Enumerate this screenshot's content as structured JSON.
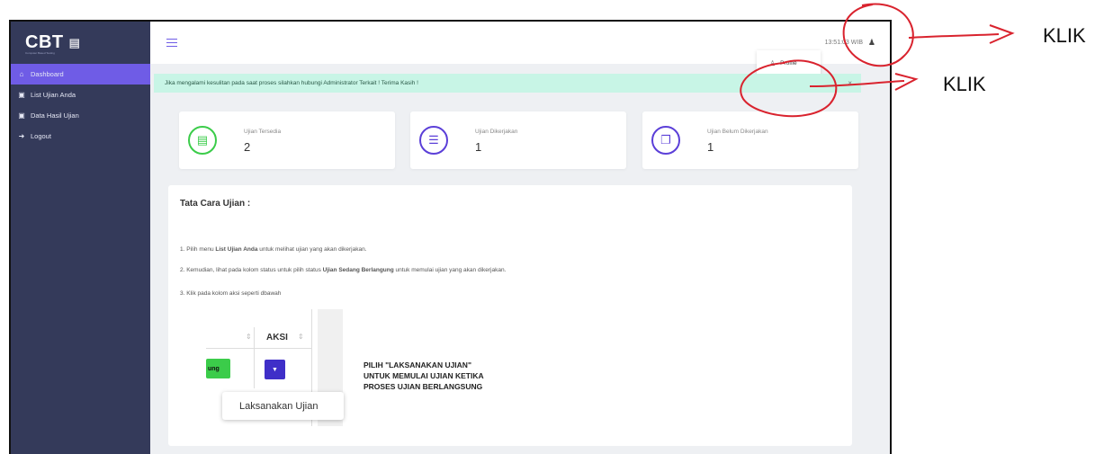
{
  "app": {
    "brand": "CBT",
    "brand_sub": "Computer Based Testing"
  },
  "sidebar": {
    "items": [
      {
        "label": "Dashboard",
        "icon": "home-icon",
        "active": true
      },
      {
        "label": "List Ujian Anda",
        "icon": "calendar-icon"
      },
      {
        "label": "Data Hasil Ujian",
        "icon": "calendar-icon"
      },
      {
        "label": "Logout",
        "icon": "logout-icon"
      }
    ]
  },
  "topbar": {
    "clock": "13:51:03 WIB",
    "user_icon": "user-icon"
  },
  "user_menu": {
    "profile_label": "Profile"
  },
  "alert": {
    "text": "Jika mengalami kesulitan pada saat proses silahkan hubungi Administrator Terkait ! Terima Kasih !",
    "close": "×"
  },
  "stats": [
    {
      "label": "Ujian Tersedia",
      "value": "2",
      "icon": "book-icon",
      "color": "#3bcc4a"
    },
    {
      "label": "Ujian Dikerjakan",
      "value": "1",
      "icon": "list-icon",
      "color": "#5b3fd8"
    },
    {
      "label": "Ujian Belum Dikerjakan",
      "value": "1",
      "icon": "copy-icon",
      "color": "#5b3fd8"
    }
  ],
  "guide": {
    "title": "Tata Cara Ujian :",
    "step1_pre": "1. Pilih menu ",
    "step1_bold": "List Ujian Anda",
    "step1_post": " untuk melihat ujian yang akan dikerjakan.",
    "step2_pre": "2. Kemudian, lihat pada kolom status untuk pilih status ",
    "step2_bold": "Ujian Sedang Berlangung",
    "step2_post": " untuk memulai ujian yang akan dikerjakan.",
    "step3": "3. Klik pada kolom aksi seperti dbawah",
    "demo": {
      "aksi_header": "AKSI",
      "status_badge": "ung",
      "action_item": "Laksanakan Ujian"
    },
    "instruction": "PILIH \"LAKSANAKAN UJIAN\" UNTUK MEMULAI UJIAN KETIKA PROSES UJIAN BERLANGSUNG"
  },
  "annotations": {
    "klik_1": "KLIK",
    "klik_2": "KLIK"
  },
  "colors": {
    "sidebar": "#343a5a",
    "accent": "#6f5ce6",
    "alert_bg": "#c8f5e6",
    "annotation_red": "#d9232e"
  }
}
